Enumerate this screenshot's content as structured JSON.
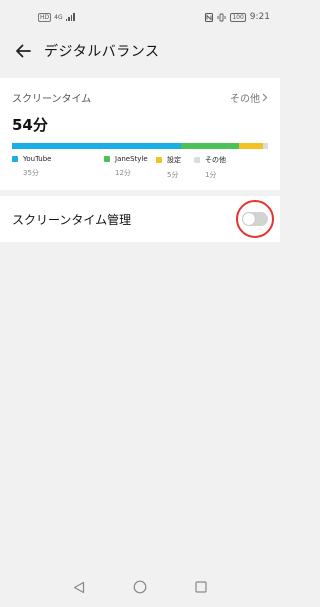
{
  "status_bar": {
    "network_badge": "HD",
    "network_type": "4G",
    "time": "9:21",
    "battery": "100"
  },
  "header": {
    "title": "デジタルバランス",
    "back_icon": "arrow-left-icon"
  },
  "screen_time": {
    "label": "スクリーンタイム",
    "more_label": "その他",
    "total": "54分",
    "items": [
      {
        "name": "YouTube",
        "time": "35分",
        "minutes": 35,
        "color": "#1aaee5"
      },
      {
        "name": "JaneStyle",
        "time": "12分",
        "minutes": 12,
        "color": "#4cc158"
      },
      {
        "name": "設定",
        "time": "5分",
        "minutes": 5,
        "color": "#f6c221"
      },
      {
        "name": "その他",
        "time": "1分",
        "minutes": 1,
        "color": "#dcdcdc"
      }
    ]
  },
  "management": {
    "label": "スクリーンタイム管理",
    "enabled": false
  },
  "colors": {
    "highlight_circle": "#e4342c",
    "toggle_off": "#d3d3d3"
  }
}
